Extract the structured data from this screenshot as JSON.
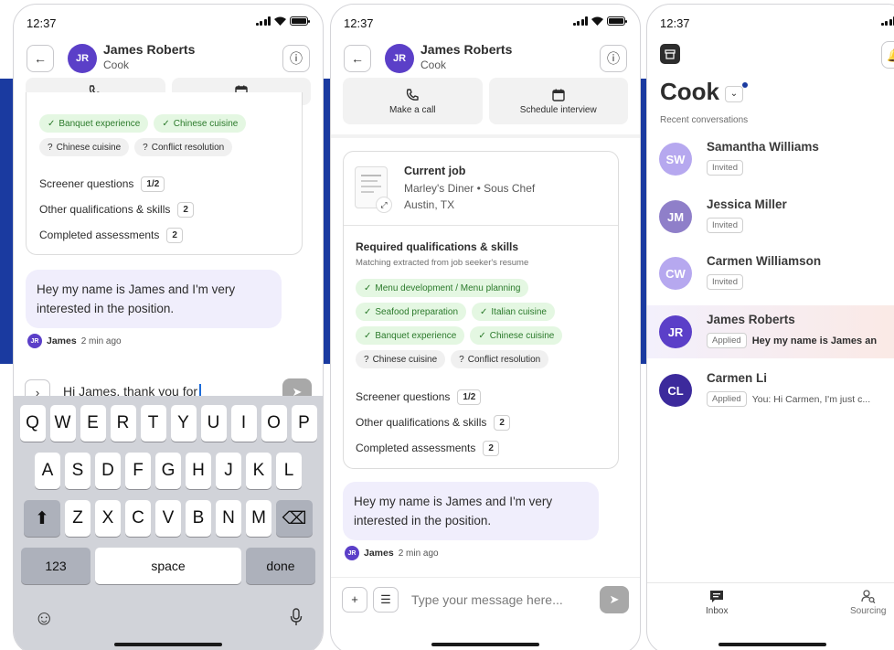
{
  "status": {
    "time": "12:37"
  },
  "colors": {
    "band": "#1a3aa0",
    "accent": "#5b3fc8",
    "chip_ok_bg": "#e4f7e2",
    "chip_ok_text": "#2b7a2b",
    "bubble": "#f0eefc",
    "highlight_row": "#fbe9e4"
  },
  "chat": {
    "name": "James Roberts",
    "initials": "JR",
    "role": "Cook",
    "make_call": "Make a call",
    "schedule_interview": "Schedule interview",
    "current_job_title": "Current job",
    "current_job_detail": "Marley's Diner • Sous Chef",
    "current_job_location": "Austin, TX",
    "required_title": "Required qualifications & skills",
    "required_subtitle": "Matching extracted from job seeker's resume",
    "chips": [
      {
        "label": "Menu development / Menu planning",
        "state": "match"
      },
      {
        "label": "Seafood preparation",
        "state": "match"
      },
      {
        "label": "Italian cuisine",
        "state": "match"
      },
      {
        "label": "Banquet experience",
        "state": "match"
      },
      {
        "label": "Chinese cuisine",
        "state": "match"
      },
      {
        "label": "Chinese cuisine",
        "state": "unknown"
      },
      {
        "label": "Conflict resolution",
        "state": "unknown"
      }
    ],
    "screener_label": "Screener questions",
    "screener_count": "1/2",
    "other_label": "Other qualifications & skills",
    "other_count": "2",
    "assessments_label": "Completed assessments",
    "assessments_count": "2",
    "message": "Hey my name is James and I'm very interested in the position.",
    "author": "James",
    "time_ago": "2 min ago",
    "draft": "Hi James, thank you for",
    "placeholder": "Type your message here..."
  },
  "keyboard": {
    "row1": [
      "Q",
      "W",
      "E",
      "R",
      "T",
      "Y",
      "U",
      "I",
      "O",
      "P"
    ],
    "row2": [
      "A",
      "S",
      "D",
      "F",
      "G",
      "H",
      "J",
      "K",
      "L"
    ],
    "row3": [
      "Z",
      "X",
      "C",
      "V",
      "B",
      "N",
      "M"
    ],
    "numbers": "123",
    "space": "space",
    "done": "done"
  },
  "inbox": {
    "title": "Cook",
    "recent": "Recent conversations",
    "conversations": [
      {
        "initials": "SW",
        "name": "Samantha Williams",
        "status": "Invited",
        "preview": "",
        "color": "#b6a8ef"
      },
      {
        "initials": "JM",
        "name": "Jessica Miller",
        "status": "Invited",
        "preview": "",
        "color": "#8f7fc9"
      },
      {
        "initials": "CW",
        "name": "Carmen Williamson",
        "status": "Invited",
        "preview": "",
        "color": "#b6a8ef"
      },
      {
        "initials": "JR",
        "name": "James Roberts",
        "status": "Applied",
        "preview": "Hey my name is James an",
        "color": "#5b3fc8"
      },
      {
        "initials": "CL",
        "name": "Carmen Li",
        "status": "Applied",
        "preview": "You: Hi Carmen, I'm just c...",
        "color": "#3c2a9c"
      }
    ],
    "nav_inbox": "Inbox",
    "nav_sourcing": "Sourcing"
  }
}
